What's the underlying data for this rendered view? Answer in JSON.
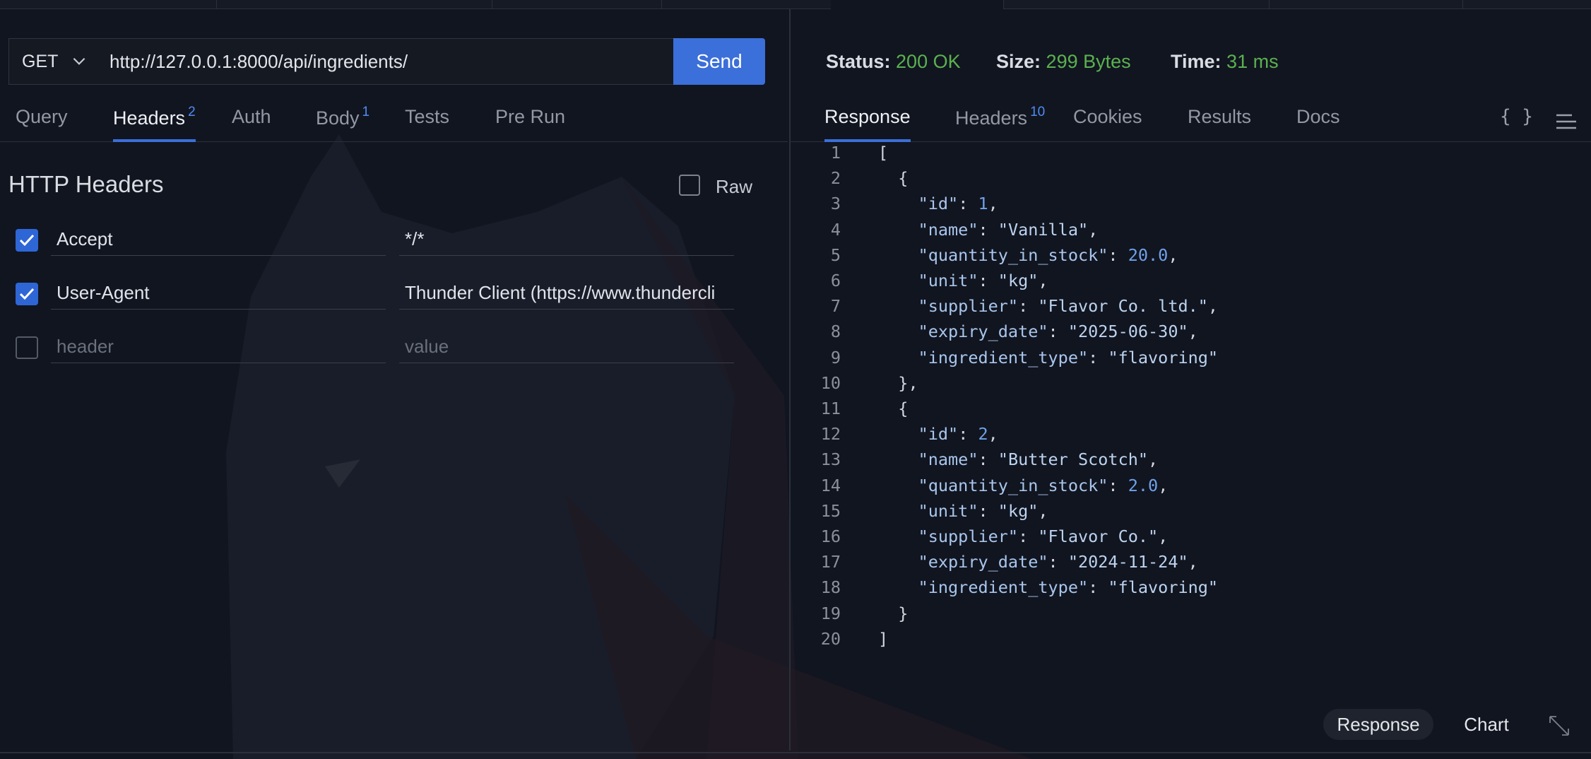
{
  "request": {
    "method": "GET",
    "url": "http://127.0.0.1:8000/api/ingredients/",
    "send_label": "Send"
  },
  "request_tabs": [
    {
      "label": "Query"
    },
    {
      "label": "Headers",
      "badge": "2"
    },
    {
      "label": "Auth"
    },
    {
      "label": "Body",
      "badge": "1"
    },
    {
      "label": "Tests"
    },
    {
      "label": "Pre Run"
    }
  ],
  "headers_panel": {
    "title": "HTTP Headers",
    "raw_label": "Raw",
    "rows": [
      {
        "checked": true,
        "header": "Accept",
        "value": "*/*"
      },
      {
        "checked": true,
        "header": "User-Agent",
        "value": "Thunder Client (https://www.thundercli"
      }
    ],
    "new_row": {
      "header_placeholder": "header",
      "value_placeholder": "value"
    }
  },
  "response_status": {
    "status_label": "Status:",
    "status_value": "200 OK",
    "size_label": "Size:",
    "size_value": "299 Bytes",
    "time_label": "Time:",
    "time_value": "31 ms"
  },
  "response_tabs": [
    {
      "label": "Response"
    },
    {
      "label": "Headers",
      "badge": "10"
    },
    {
      "label": "Cookies"
    },
    {
      "label": "Results"
    },
    {
      "label": "Docs"
    }
  ],
  "response_icons": {
    "format": "{ }",
    "menu": "menu-icon"
  },
  "response_lines": [
    "[",
    "  {",
    "    \"id\": 1,",
    "    \"name\": \"Vanilla\",",
    "    \"quantity_in_stock\": 20.0,",
    "    \"unit\": \"kg\",",
    "    \"supplier\": \"Flavor Co. ltd.\",",
    "    \"expiry_date\": \"2025-06-30\",",
    "    \"ingredient_type\": \"flavoring\"",
    "  },",
    "  {",
    "    \"id\": 2,",
    "    \"name\": \"Butter Scotch\",",
    "    \"quantity_in_stock\": 2.0,",
    "    \"unit\": \"kg\",",
    "    \"supplier\": \"Flavor Co.\",",
    "    \"expiry_date\": \"2024-11-24\",",
    "    \"ingredient_type\": \"flavoring\"",
    "  }",
    "]"
  ],
  "bottom_buttons": {
    "response": "Response",
    "chart": "Chart"
  },
  "colors": {
    "accent": "#3b6fd9",
    "success": "#5bb14f",
    "background": "#111520"
  }
}
